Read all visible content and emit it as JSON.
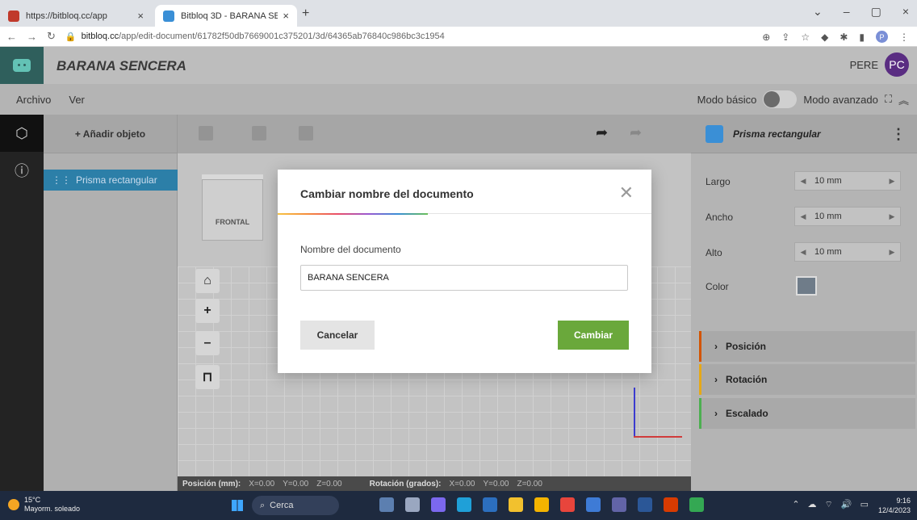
{
  "browser": {
    "tabs": [
      {
        "title": "https://bitbloq.cc/app",
        "favicon_color": "#c0392b"
      },
      {
        "title": "Bitbloq 3D - BARANA SENCERA",
        "favicon_color": "#3a8fd6"
      }
    ],
    "url_host": "bitbloq.cc",
    "url_path": "/app/edit-document/61782f50db7669001c375201/3d/64365ab76840c986bc3c1954",
    "profile_initial": "P"
  },
  "app": {
    "document_title": "BARANA SENCERA",
    "user_name": "PERE",
    "user_initials": "PC",
    "menu": [
      "Archivo",
      "Ver"
    ],
    "mode_basic": "Modo básico",
    "mode_advanced": "Modo avanzado"
  },
  "object_panel": {
    "add_label": "+ Añadir objeto",
    "objects": [
      "Prisma rectangular"
    ]
  },
  "viewport": {
    "cube_face": "FRONTAL"
  },
  "status": {
    "pos_label": "Posición (mm):",
    "x": "X=0.00",
    "y": "Y=0.00",
    "z": "Z=0.00",
    "rot_label": "Rotación (grados):",
    "rx": "X=0.00",
    "ry": "Y=0.00",
    "rz": "Z=0.00"
  },
  "properties": {
    "object_name": "Prisma rectangular",
    "largo_label": "Largo",
    "largo_value": "10 mm",
    "ancho_label": "Ancho",
    "ancho_value": "10 mm",
    "alto_label": "Alto",
    "alto_value": "10 mm",
    "color_label": "Color",
    "color_value": "#6f7c89",
    "sections": [
      "Posición",
      "Rotación",
      "Escalado"
    ],
    "section_colors": [
      "#d35400",
      "#e6a817",
      "#4caf50"
    ]
  },
  "modal": {
    "title": "Cambiar nombre del documento",
    "field_label": "Nombre del documento",
    "field_value": "BARANA SENCERA",
    "cancel_label": "Cancelar",
    "confirm_label": "Cambiar"
  },
  "taskbar": {
    "temp": "15°C",
    "weather": "Mayorm. soleado",
    "search_placeholder": "Cerca",
    "time": "9:16",
    "date": "12/4/2023"
  }
}
